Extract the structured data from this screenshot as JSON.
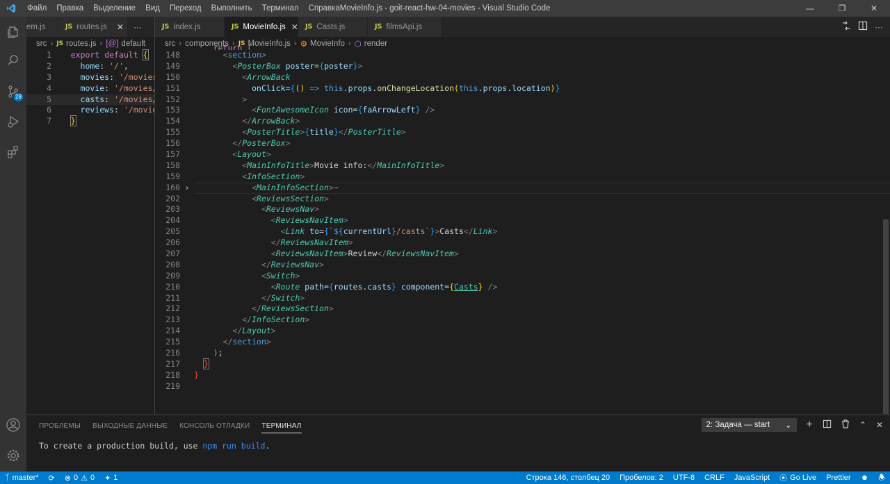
{
  "titlebar": {
    "menu": [
      "Файл",
      "Правка",
      "Выделение",
      "Вид",
      "Переход",
      "Выполнить",
      "Терминал",
      "Справка"
    ],
    "title": "MovieInfo.js - goit-react-hw-04-movies - Visual Studio Code"
  },
  "activity": {
    "source_control_badge": "28"
  },
  "left_group": {
    "tabs": [
      {
        "label": "em.js",
        "icon": "",
        "active": false
      },
      {
        "label": "routes.js",
        "icon": "JS",
        "active": true
      }
    ],
    "breadcrumb": [
      "src",
      "routes.js",
      "default"
    ],
    "lines": [
      {
        "n": "1"
      },
      {
        "n": "2"
      },
      {
        "n": "3"
      },
      {
        "n": "4"
      },
      {
        "n": "5"
      },
      {
        "n": "6"
      },
      {
        "n": "7"
      }
    ]
  },
  "right_group": {
    "tabs": [
      {
        "label": "index.js",
        "icon": "JS"
      },
      {
        "label": "MovieInfo.js",
        "icon": "JS"
      },
      {
        "label": "Casts.js",
        "icon": "JS"
      },
      {
        "label": "filmsApi.js",
        "icon": "JS"
      }
    ],
    "breadcrumb": [
      "src",
      "components",
      "MovieInfo.js",
      "MovieInfo",
      "render"
    ],
    "line_numbers": [
      "148",
      "149",
      "150",
      "151",
      "152",
      "153",
      "154",
      "155",
      "156",
      "157",
      "158",
      "159",
      "160",
      "202",
      "203",
      "204",
      "205",
      "206",
      "207",
      "208",
      "209",
      "210",
      "211",
      "212",
      "213",
      "214",
      "215",
      "216",
      "217",
      "218",
      "219"
    ]
  },
  "panel": {
    "tabs": [
      "ПРОБЛЕМЫ",
      "ВЫХОДНЫЕ ДАННЫЕ",
      "КОНСОЛЬ ОТЛАДКИ",
      "ТЕРМИНАЛ"
    ],
    "active_tab": "ТЕРМИНАЛ",
    "task_select": "2: Задача — start",
    "terminal_prefix": "To create a production build, use ",
    "terminal_cmd": "npm run build",
    "terminal_suffix": "."
  },
  "status": {
    "branch": "master*",
    "errors": "0",
    "warnings": "0",
    "live_share": "1",
    "position": "Строка 146, столбец 20",
    "spaces": "Пробелов: 2",
    "encoding": "UTF-8",
    "eol": "CRLF",
    "language": "JavaScript",
    "golive": "Go Live",
    "prettier": "Prettier"
  },
  "colors": {
    "accent": "#007acc",
    "editor_bg": "#1e1e1e",
    "titlebar_bg": "#3c3c3c"
  }
}
